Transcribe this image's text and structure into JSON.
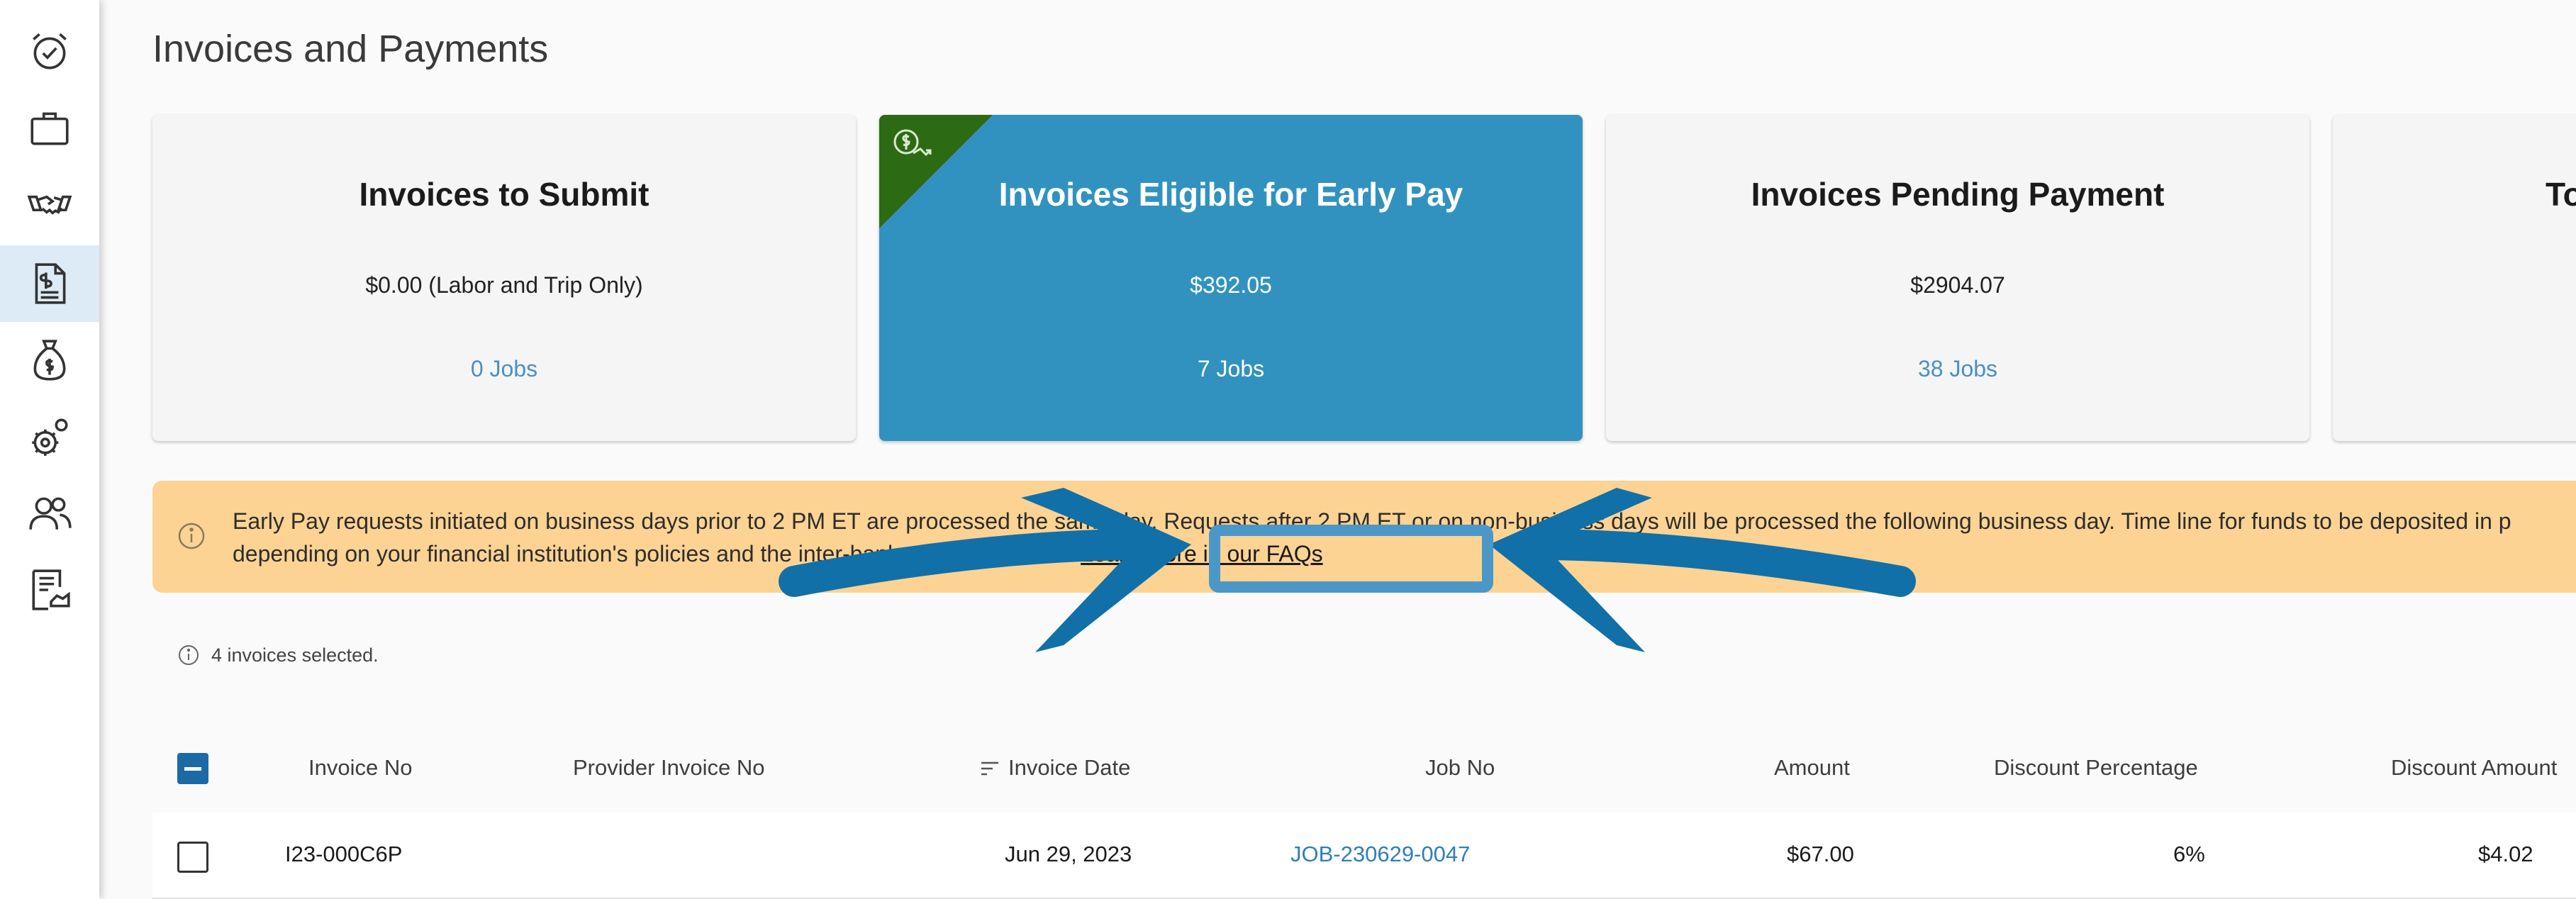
{
  "sidebar": {
    "items": [
      {
        "icon": "alarm-clock-icon"
      },
      {
        "icon": "briefcase-icon"
      },
      {
        "icon": "handshake-icon"
      },
      {
        "icon": "invoice-document-icon",
        "active": true
      },
      {
        "icon": "money-bag-icon"
      },
      {
        "icon": "settings-gears-icon"
      },
      {
        "icon": "users-icon"
      },
      {
        "icon": "contract-icon"
      }
    ]
  },
  "page": {
    "title": "Invoices and Payments"
  },
  "cards": [
    {
      "title": "Invoices to Submit",
      "amount": "$0.00 (Labor and Trip Only)",
      "jobs": "0 Jobs"
    },
    {
      "title": "Invoices Eligible for Early Pay",
      "amount": "$392.05",
      "jobs": "7 Jobs",
      "featured": true
    },
    {
      "title": "Invoices Pending Payment",
      "amount": "$2904.07",
      "jobs": "38 Jobs"
    },
    {
      "title": "To"
    }
  ],
  "banner": {
    "line1": "Early Pay requests initiated on business days prior to 2 PM ET are processed the same day. Requests after 2 PM ET or on non-business days will be processed the following business day. Time line for funds to be deposited in p",
    "line2_prefix": "depending on your financial institution's policies and the inter-bank transfer process. ",
    "faq_link": "Learn more in our FAQs"
  },
  "selection": {
    "text": "4 invoices selected."
  },
  "table": {
    "columns": {
      "invoice_no": "Invoice No",
      "provider_invoice_no": "Provider Invoice No",
      "invoice_date": "Invoice Date",
      "job_no": "Job No",
      "amount": "Amount",
      "discount_percentage": "Discount Percentage",
      "discount_amount": "Discount Amount"
    },
    "rows": [
      {
        "invoice_no": "I23-000C6P",
        "provider_invoice_no": "",
        "invoice_date": "Jun 29, 2023",
        "job_no": "JOB-230629-0047",
        "amount": "$67.00",
        "discount_percentage": "6%",
        "discount_amount": "$4.02"
      }
    ]
  },
  "colors": {
    "accent": "#3192c0",
    "ribbon": "#2c6b14",
    "banner": "#fcd393",
    "link": "#2f7fb8",
    "annotation": "#1170a8"
  }
}
